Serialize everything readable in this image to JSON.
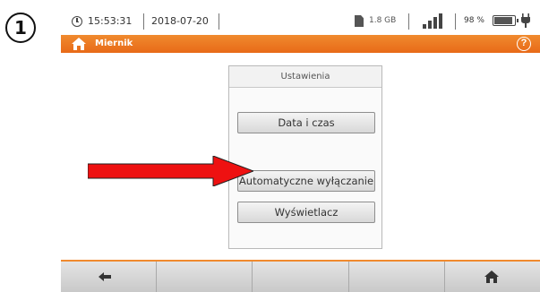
{
  "step": {
    "number": "1"
  },
  "status_bar": {
    "time": "15:53:31",
    "date": "2018-07-20",
    "storage": "1.8 GB",
    "battery_percent": "98 %",
    "signal_level": 1.0,
    "battery_level": 0.98
  },
  "title_bar": {
    "title": "Miernik",
    "icons": [
      "home-icon",
      "help-icon"
    ],
    "color": "#e86a18"
  },
  "settings_panel": {
    "header": "Ustawienia",
    "items": [
      {
        "label": "Data i czas"
      },
      {
        "label": "Automatyczne wyłączanie"
      },
      {
        "label": "Wyświetlacz"
      }
    ]
  },
  "annotation": {
    "arrow_color": "#ee1111",
    "points_to": "Automatyczne wyłączanie"
  },
  "toolbar": {
    "icons": [
      "back-arrow-icon",
      "",
      "",
      "",
      "home-icon"
    ]
  }
}
